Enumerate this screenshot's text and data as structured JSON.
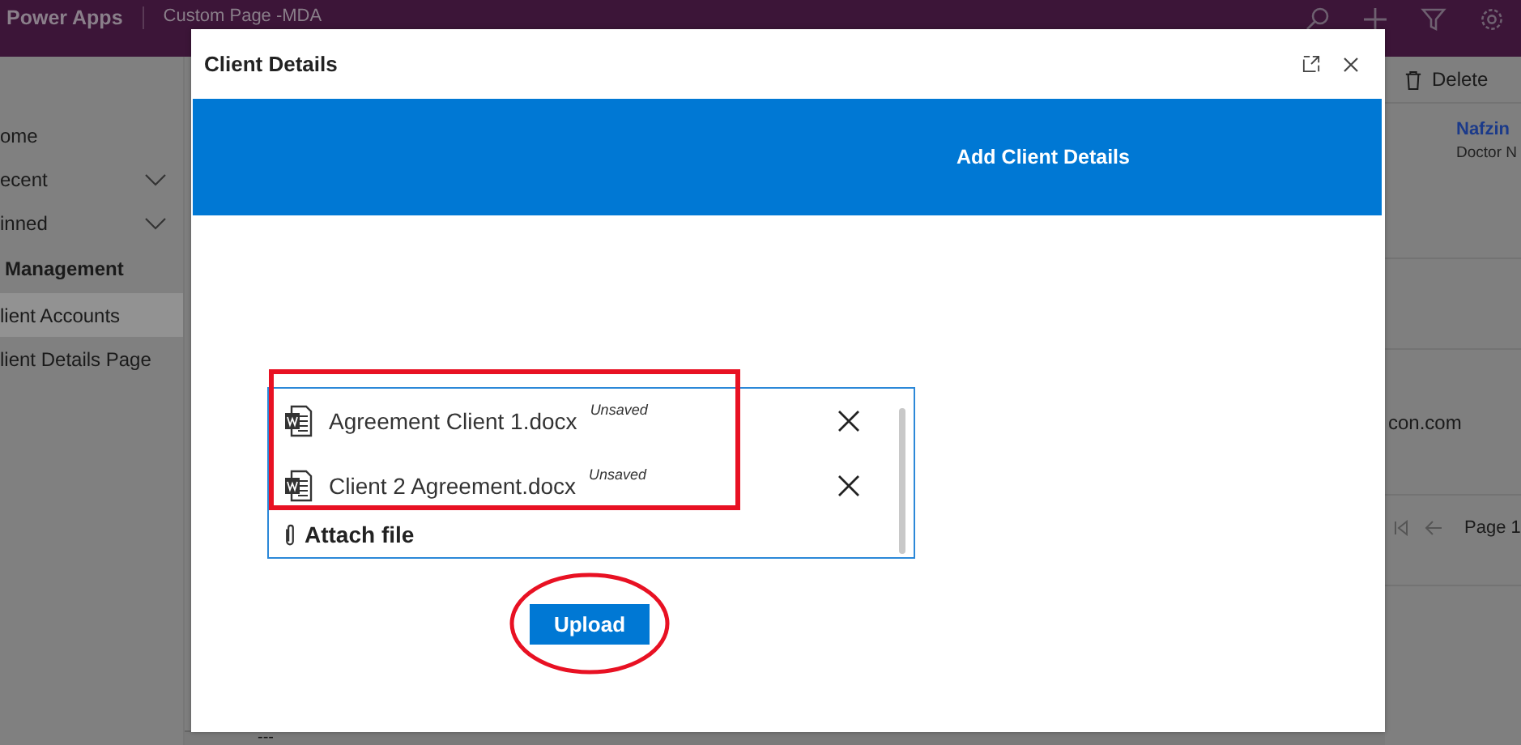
{
  "top_bar": {
    "app_name": "Power Apps",
    "page_title": "Custom Page -MDA"
  },
  "sidebar": {
    "items": [
      {
        "label": "ome",
        "kind": "link",
        "selected": false
      },
      {
        "label": "ecent",
        "kind": "group",
        "selected": false
      },
      {
        "label": "inned",
        "kind": "group",
        "selected": false
      },
      {
        "label": "Management",
        "kind": "heading",
        "selected": false
      },
      {
        "label": "lient Accounts",
        "kind": "link",
        "selected": true
      },
      {
        "label": "lient Details Page",
        "kind": "link",
        "selected": false
      }
    ]
  },
  "command_bar": {
    "delete_label": "Delete"
  },
  "record": {
    "name": "Nafzin",
    "subtitle": "Doctor N",
    "email": "con.com"
  },
  "pagination": {
    "page": "Page 1"
  },
  "grid_footer": "---",
  "dialog": {
    "title": "Client Details",
    "banner": "Add Client Details",
    "attachments": [
      {
        "file_name": "Agreement Client 1.docx",
        "status": "Unsaved"
      },
      {
        "file_name": "Client 2 Agreement.docx",
        "status": "Unsaved"
      }
    ],
    "attach_label": "Attach file",
    "upload_label": "Upload"
  }
}
